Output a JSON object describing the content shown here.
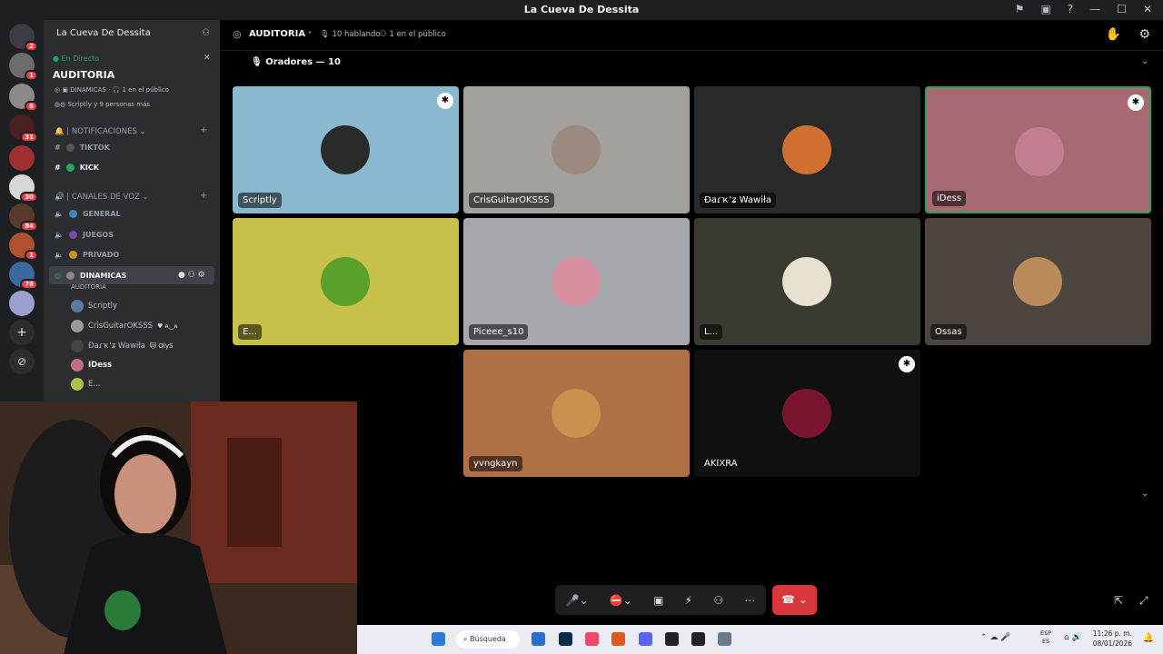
{
  "window": {
    "title": "La Cueva De Dessita",
    "controls": [
      "⚑",
      "▣",
      "?",
      "—",
      "☐",
      "✕"
    ]
  },
  "sidebar": {
    "server_name": "La Cueva De Dessita",
    "live_label": "En Directo",
    "stage_name": "AUDITORIA",
    "stage_channel": "DINAMICAS",
    "audience": "1 en el público",
    "listeners": "Scriptly y 9 personas más",
    "categories": [
      {
        "label": "| NOTIFICACIONES",
        "channels": [
          "TIKTOK",
          "KICK"
        ]
      },
      {
        "label": "| CANALES DE VOZ",
        "channels": [
          "GENERAL",
          "JUEGOS",
          "PRIVADO",
          "DINAMICAS"
        ]
      }
    ],
    "active_sub": "AUDITORIA",
    "members": [
      {
        "name": "Scriptly",
        "color": "#5b7a9e"
      },
      {
        "name": "CrisGuitarOKSSS",
        "color": "#9a9a9a"
      },
      {
        "name": "Ɖaɾҡ'ʑ Wawiła",
        "color": "#444"
      },
      {
        "name": "IDess",
        "color": "#c07080"
      },
      {
        "name": "E...",
        "color": "#a9c34a"
      }
    ],
    "member_tags": [
      "♥ ᴀ‿ᴀ",
      "🐱 OlyS"
    ]
  },
  "rail": {
    "badges": [
      "2",
      "1",
      "6",
      "31",
      "30",
      "84",
      "1",
      "78"
    ]
  },
  "stage": {
    "title": "AUDITORIA",
    "speaking": "10 hablando",
    "audience": "1 en el público",
    "speakers_label": "Oradores — 10"
  },
  "tiles": [
    {
      "name": "Scriptly",
      "bg": "#8ab8cf",
      "avatar": "#2a2a2a",
      "mod": true
    },
    {
      "name": "CrisGuitarOKSSS",
      "bg": "#a4a09c",
      "avatar": "#9a8a80",
      "mod": false
    },
    {
      "name": "Ɖaɾҡ'ʑ Wawiła",
      "bg": "#2a2a2b",
      "avatar": "#d07030",
      "mod": false
    },
    {
      "name": "iDess",
      "bg": "#a86a72",
      "avatar": "#c08090",
      "mod": true
    },
    {
      "name": "E...",
      "bg": "#c7c04b",
      "avatar": "#5aa02a",
      "mod": false
    },
    {
      "name": "Piceee_s10",
      "bg": "#a5a9ae",
      "avatar": "#d890a0",
      "mod": false
    },
    {
      "name": "L...",
      "bg": "#3b3a30",
      "avatar": "#e8e0d0",
      "mod": false
    },
    {
      "name": "Ossas",
      "bg": "#4d4640",
      "avatar": "#b98a5a",
      "mod": false
    },
    {
      "name": "yvngkayn",
      "bg": "#b07045",
      "avatar": "#c9904e",
      "mod": false
    },
    {
      "name": "AKIXRA",
      "bg": "#101010",
      "avatar": "#7a1530",
      "mod": true
    }
  ],
  "taskbar": {
    "search": "Búsqueda",
    "lang_top": "ESP",
    "lang_bottom": "ES",
    "time": "11:26 p. m.",
    "date": "08/01/2026"
  }
}
